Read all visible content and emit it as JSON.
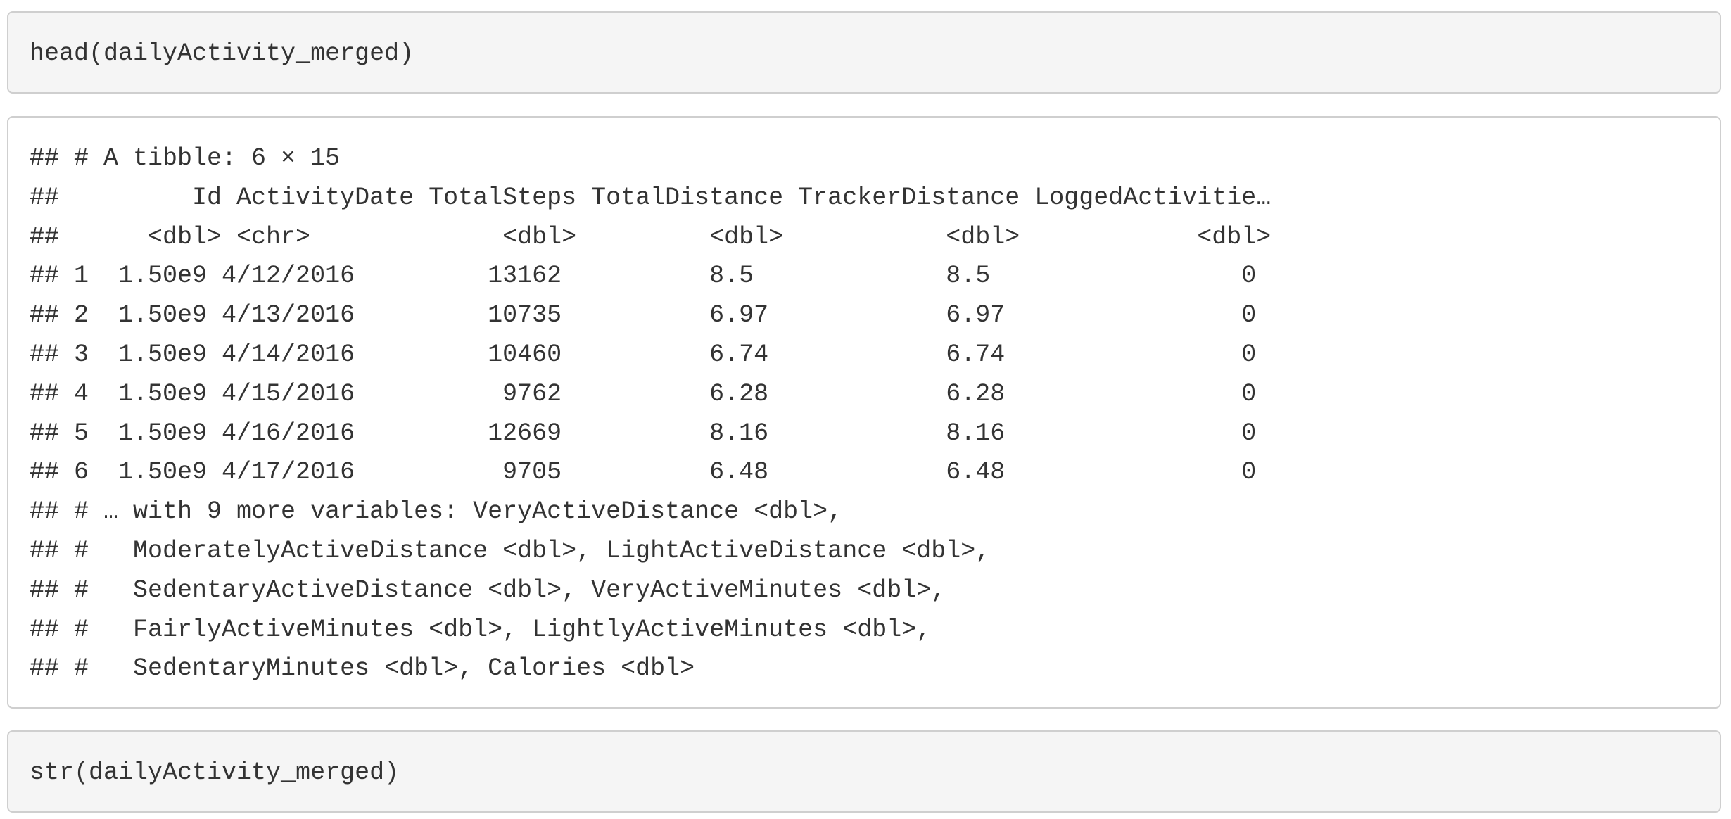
{
  "code_cells": [
    {
      "code": "head(dailyActivity_merged)"
    },
    {
      "code": "str(dailyActivity_merged)"
    }
  ],
  "output": {
    "lines": [
      "## # A tibble: 6 × 15",
      "##         Id ActivityDate TotalSteps TotalDistance TrackerDistance LoggedActivitie…",
      "##      <dbl> <chr>             <dbl>         <dbl>           <dbl>            <dbl>",
      "## 1  1.50e9 4/12/2016         13162          8.5             8.5                 0",
      "## 2  1.50e9 4/13/2016         10735          6.97            6.97                0",
      "## 3  1.50e9 4/14/2016         10460          6.74            6.74                0",
      "## 4  1.50e9 4/15/2016          9762          6.28            6.28                0",
      "## 5  1.50e9 4/16/2016         12669          8.16            8.16                0",
      "## 6  1.50e9 4/17/2016          9705          6.48            6.48                0",
      "## # … with 9 more variables: VeryActiveDistance <dbl>,",
      "## #   ModeratelyActiveDistance <dbl>, LightActiveDistance <dbl>,",
      "## #   SedentaryActiveDistance <dbl>, VeryActiveMinutes <dbl>,",
      "## #   FairlyActiveMinutes <dbl>, LightlyActiveMinutes <dbl>,",
      "## #   SedentaryMinutes <dbl>, Calories <dbl>"
    ]
  }
}
